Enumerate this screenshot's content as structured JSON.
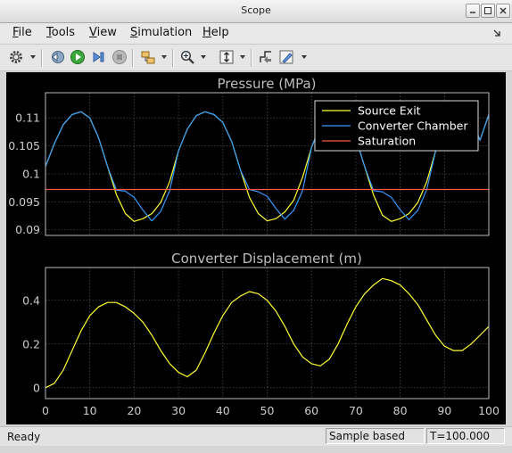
{
  "window": {
    "title": "Scope"
  },
  "menu": {
    "items": [
      "File",
      "Tools",
      "View",
      "Simulation",
      "Help"
    ]
  },
  "toolbar": {
    "icons": [
      "gear-icon",
      "step-back-icon",
      "run-icon",
      "step-forward-icon",
      "stop-icon",
      "highlight-block-icon",
      "zoom-icon",
      "autoscale-icon",
      "triggers-icon",
      "style-icon"
    ]
  },
  "colors": {
    "source_exit": "#ffff33",
    "converter_chamber": "#3399ff",
    "saturation": "#ff5544",
    "axis": "#bbbbbb"
  },
  "chart_data": [
    {
      "type": "line",
      "title": "Pressure (MPa)",
      "xlim": [
        0,
        100
      ],
      "ylim": [
        0.089,
        0.1145
      ],
      "yticks": [
        "0.09",
        "0.095",
        "0.1",
        "0.105",
        "0.11"
      ],
      "grid": true,
      "legend_position": "top-right",
      "series": [
        {
          "name": "Source Exit",
          "color": "#ffff33",
          "x": [
            0,
            2,
            4,
            6,
            8,
            10,
            12,
            14,
            16,
            18,
            20,
            22,
            24,
            26,
            28,
            30,
            32,
            34,
            36,
            38,
            40,
            42,
            44,
            46,
            48,
            50,
            52,
            54,
            56,
            58,
            60,
            62,
            64,
            66,
            68,
            70,
            72,
            74,
            76,
            78,
            80,
            82,
            84,
            86,
            88,
            90,
            92,
            94,
            96,
            98,
            100
          ],
          "y": [
            0.1013,
            0.1054,
            0.1088,
            0.1106,
            0.1111,
            0.11,
            0.1064,
            0.1013,
            0.0963,
            0.0929,
            0.0915,
            0.092,
            0.0929,
            0.0949,
            0.0986,
            0.1041,
            0.108,
            0.1104,
            0.1111,
            0.1106,
            0.1092,
            0.1058,
            0.1006,
            0.0958,
            0.0929,
            0.0916,
            0.092,
            0.0932,
            0.0953,
            0.0994,
            0.1047,
            0.1087,
            0.1106,
            0.1111,
            0.11,
            0.1064,
            0.1013,
            0.0962,
            0.0926,
            0.0915,
            0.092,
            0.0929,
            0.0949,
            0.0986,
            0.1041,
            0.108,
            0.1101,
            0.1106,
            0.1098,
            0.106,
            0.1106
          ]
        },
        {
          "name": "Converter Chamber",
          "color": "#3399ff",
          "x": [
            0,
            2,
            4,
            6,
            8,
            10,
            12,
            14,
            16,
            18,
            20,
            22,
            24,
            26,
            28,
            30,
            32,
            34,
            36,
            38,
            40,
            42,
            44,
            46,
            48,
            50,
            52,
            54,
            56,
            58,
            60,
            62,
            64,
            66,
            68,
            70,
            72,
            74,
            76,
            78,
            80,
            82,
            84,
            86,
            88,
            90,
            92,
            94,
            96,
            98,
            100
          ],
          "y": [
            0.1013,
            0.1054,
            0.1088,
            0.1106,
            0.1111,
            0.11,
            0.1064,
            0.1013,
            0.0971,
            0.0969,
            0.0958,
            0.0935,
            0.0916,
            0.0933,
            0.097,
            0.1041,
            0.108,
            0.1104,
            0.1111,
            0.1106,
            0.1092,
            0.1058,
            0.1006,
            0.0972,
            0.0968,
            0.096,
            0.0938,
            0.0919,
            0.0935,
            0.097,
            0.1047,
            0.1087,
            0.1106,
            0.1111,
            0.11,
            0.1064,
            0.1013,
            0.097,
            0.0968,
            0.0958,
            0.0936,
            0.0918,
            0.0935,
            0.0972,
            0.1041,
            0.108,
            0.1101,
            0.1106,
            0.1098,
            0.106,
            0.1106
          ]
        },
        {
          "name": "Saturation",
          "color": "#ff5544",
          "x": [
            0,
            100
          ],
          "y": [
            0.0972,
            0.0972
          ]
        }
      ]
    },
    {
      "type": "line",
      "title": "Converter Displacement (m)",
      "xlim": [
        0,
        100
      ],
      "ylim": [
        -0.05,
        0.55
      ],
      "xticks": [
        "0",
        "10",
        "20",
        "30",
        "40",
        "50",
        "60",
        "70",
        "80",
        "90",
        "100"
      ],
      "yticks": [
        "0",
        "0.2",
        "0.4"
      ],
      "grid": true,
      "series": [
        {
          "name": "",
          "color": "#ffff33",
          "x": [
            0,
            2,
            4,
            6,
            8,
            10,
            12,
            14,
            16,
            18,
            20,
            22,
            24,
            26,
            28,
            30,
            32,
            34,
            36,
            38,
            40,
            42,
            44,
            46,
            48,
            50,
            52,
            54,
            56,
            58,
            60,
            62,
            64,
            66,
            68,
            70,
            72,
            74,
            76,
            78,
            80,
            82,
            84,
            86,
            88,
            90,
            92,
            94,
            96,
            98,
            100
          ],
          "y": [
            0.0,
            0.02,
            0.08,
            0.17,
            0.26,
            0.33,
            0.37,
            0.39,
            0.39,
            0.37,
            0.34,
            0.3,
            0.24,
            0.17,
            0.11,
            0.07,
            0.05,
            0.08,
            0.16,
            0.25,
            0.33,
            0.39,
            0.42,
            0.44,
            0.43,
            0.4,
            0.35,
            0.28,
            0.2,
            0.14,
            0.11,
            0.1,
            0.13,
            0.2,
            0.29,
            0.37,
            0.43,
            0.47,
            0.5,
            0.49,
            0.47,
            0.43,
            0.38,
            0.31,
            0.24,
            0.19,
            0.17,
            0.17,
            0.2,
            0.24,
            0.28
          ]
        }
      ]
    }
  ],
  "status": {
    "ready": "Ready",
    "mode": "Sample based",
    "time": "T=100.000"
  }
}
